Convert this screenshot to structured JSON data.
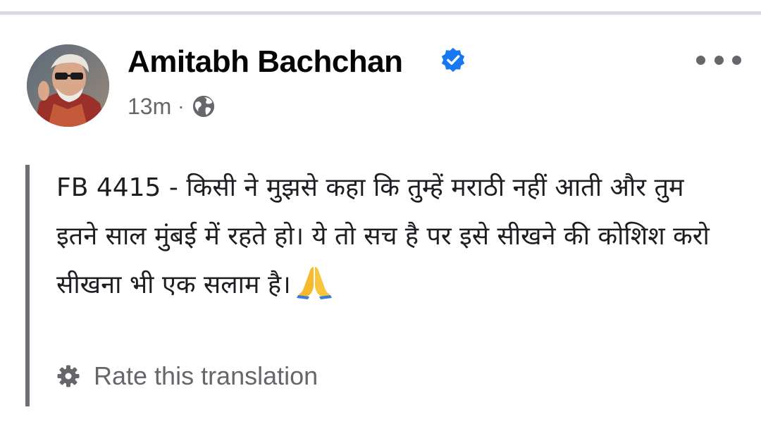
{
  "post": {
    "author_name": "Amitabh Bachchan",
    "verified_icon": "verified-badge-icon",
    "timestamp": "13m",
    "separator": "·",
    "privacy_icon": "globe-icon",
    "more_icon": "more-options-icon",
    "text": "FB 4415 - किसी ने मुझसे कहा कि तुम्हें मराठी नहीं आती और तुम इतने साल मुंबई में रहते हो। ये तो सच है पर इसे सीखने की कोशिश करो सीखना भी एक सलाम है।",
    "emoji_icon": "folded-hands-emoji",
    "translation": {
      "icon": "gear-icon",
      "label": "Rate this translation"
    }
  },
  "colors": {
    "verified_blue": "#1877f2",
    "secondary_text": "#65676b",
    "quote_bar": "#6d6f74",
    "divider": "#d9dadf"
  }
}
